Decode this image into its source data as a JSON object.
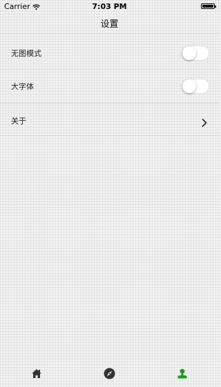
{
  "status_bar": {
    "carrier": "Carrier",
    "time": "7:03 PM"
  },
  "nav": {
    "title": "设置"
  },
  "settings": [
    {
      "label": "无图模式",
      "control": "toggle",
      "on": false
    },
    {
      "label": "大字体",
      "control": "toggle",
      "on": false
    },
    {
      "label": "关于",
      "control": "disclosure"
    }
  ],
  "tab_bar": {
    "items": [
      {
        "icon": "home-icon",
        "selected": false
      },
      {
        "icon": "compass-icon",
        "selected": false
      },
      {
        "icon": "person-icon",
        "selected": true
      }
    ],
    "selected_color": "#1a9d1a",
    "unselected_color": "#333333"
  }
}
